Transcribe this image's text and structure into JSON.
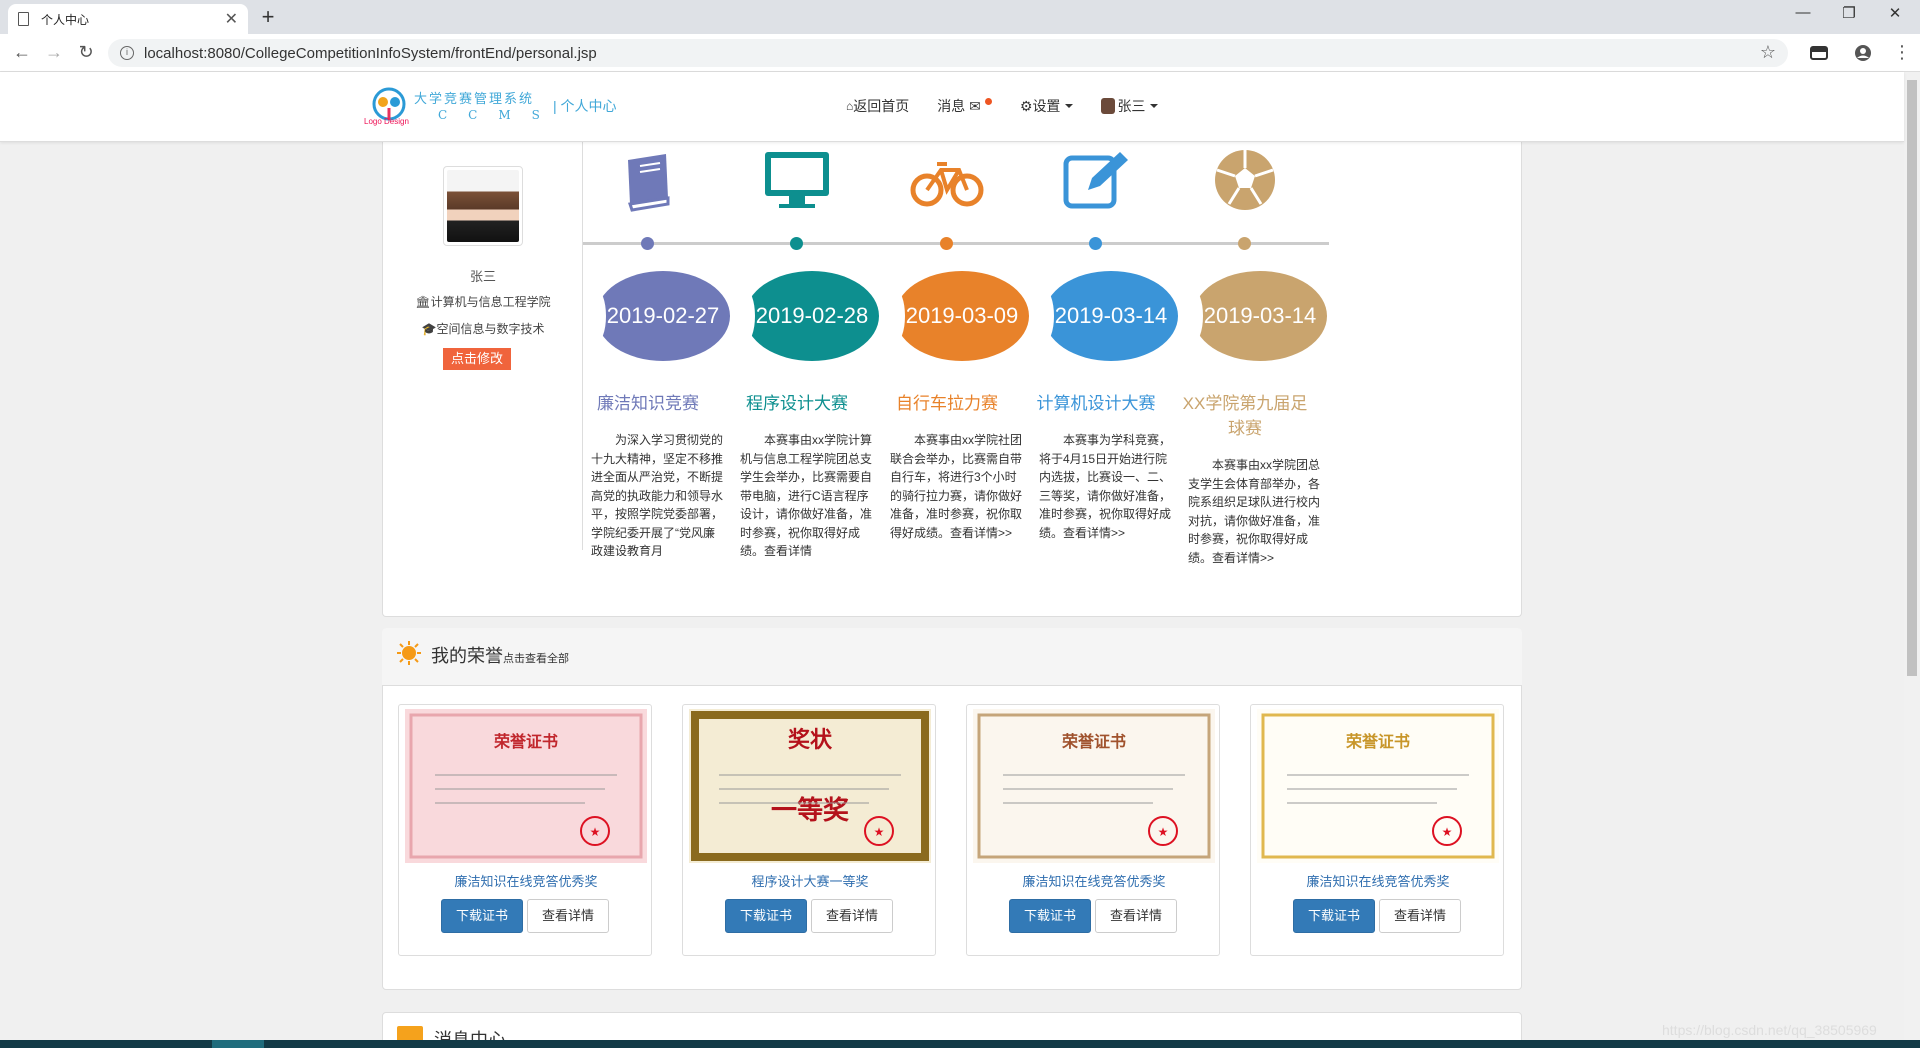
{
  "browser": {
    "tab_title": "个人中心",
    "url": "localhost:8080/CollegeCompetitionInfoSystem/frontEnd/personal.jsp"
  },
  "site": {
    "logo_text": "Logo Design",
    "brand_line1": "大学竞赛管理系统",
    "brand_line2": "CCMS",
    "brand_sub": "| 个人中心",
    "nav": {
      "home": "返回首页",
      "messages": "消息",
      "settings": "设置",
      "user": "张三"
    }
  },
  "profile": {
    "name": "张三",
    "college": "计算机与信息工程学院",
    "major": "空间信息与数字技术",
    "edit_label": "点击修改"
  },
  "timeline": [
    {
      "icon": "book-icon",
      "color": "#6f79b8",
      "date": "2019-02-27",
      "title": "廉洁知识竞赛",
      "desc": "为深入学习贯彻党的十九大精神，坚定不移推进全面从严治党，不断提高党的执政能力和领导水平，按照学院党委部署，学院纪委开展了“党风廉政建设教育月"
    },
    {
      "icon": "monitor-icon",
      "color": "#0d8f8f",
      "date": "2019-02-28",
      "title": "程序设计大赛",
      "desc": "本赛事由xx学院计算机与信息工程学院团总支学生会举办，比赛需要自带电脑，进行C语言程序设计，请你做好准备，准时参赛，祝你取得好成绩。查看详情"
    },
    {
      "icon": "bicycle-icon",
      "color": "#e8822a",
      "date": "2019-03-09",
      "title": "自行车拉力赛",
      "desc": "本赛事由xx学院社团联合会举办，比赛需自带自行车，将进行3个小时的骑行拉力赛，请你做好准备，准时参赛，祝你取得好成绩。查看详情>>"
    },
    {
      "icon": "edit-icon",
      "color": "#3a94d8",
      "date": "2019-03-14",
      "title": "计算机设计大赛",
      "desc": "本赛事为学科竞赛，将于4月15日开始进行院内选拔，比赛设一、二、三等奖，请你做好准备，准时参赛，祝你取得好成绩。查看详情>>"
    },
    {
      "icon": "soccer-icon",
      "color": "#c9a46e",
      "date": "2019-03-14",
      "title": "XX学院第九届足球赛",
      "desc": "本赛事由xx学院团总支学生会体育部举办，各院系组织足球队进行校内对抗，请你做好准备，准时参赛，祝你取得好成绩。查看详情>>"
    }
  ],
  "honors": {
    "title": "我的荣誉",
    "more": "点击查看全部",
    "items": [
      {
        "name": "廉洁知识在线竞答优秀奖",
        "style": "pink",
        "cert_title": "荣誉证书"
      },
      {
        "name": "程序设计大赛一等奖",
        "style": "gold",
        "cert_title": "奖状",
        "cert_prize": "一等奖"
      },
      {
        "name": "廉洁知识在线竞答优秀奖",
        "style": "cream",
        "cert_title": "荣誉证书"
      },
      {
        "name": "廉洁知识在线竞答优秀奖",
        "style": "white",
        "cert_title": "荣誉证书"
      }
    ],
    "download_label": "下载证书",
    "view_label": "查看详情"
  },
  "messages": {
    "title": "消息中心"
  },
  "watermark": "https://blog.csdn.net/qq_38505969"
}
